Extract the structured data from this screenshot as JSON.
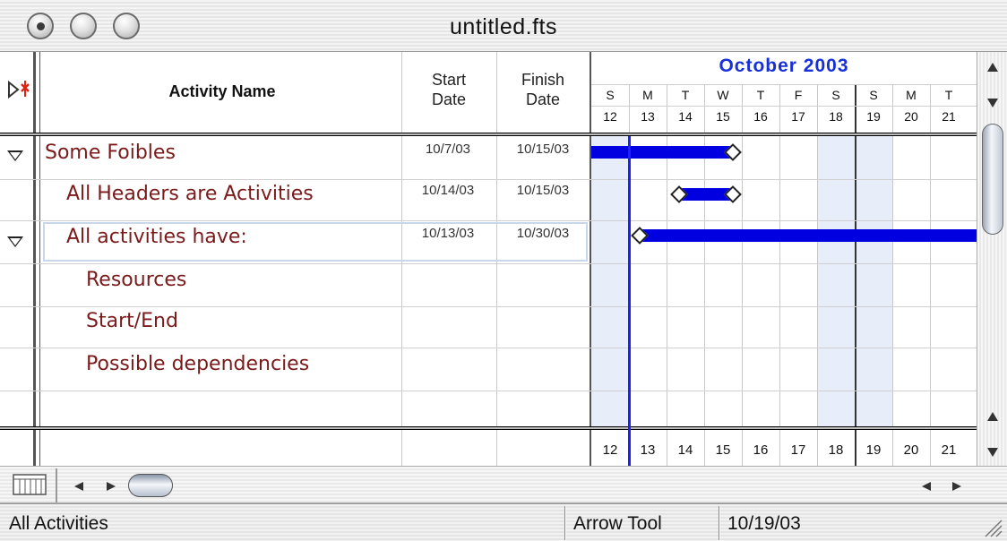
{
  "window": {
    "title": "untitled.fts"
  },
  "header": {
    "activity_name": "Activity Name",
    "start_line1": "Start",
    "start_line2": "Date",
    "finish_line1": "Finish",
    "finish_line2": "Date",
    "month": "October  2003",
    "day_letters": [
      "S",
      "M",
      "T",
      "W",
      "T",
      "F",
      "S",
      "S",
      "M",
      "T"
    ],
    "day_numbers": [
      "12",
      "13",
      "14",
      "15",
      "16",
      "17",
      "18",
      "19",
      "20",
      "21"
    ]
  },
  "rows": [
    {
      "name": "Some Foibles",
      "start": "10/7/03",
      "finish": "10/15/03",
      "expandable": true
    },
    {
      "name": "All Headers are Activities",
      "start": "10/14/03",
      "finish": "10/15/03",
      "expandable": false
    },
    {
      "name": "All activities have:",
      "start": "10/13/03",
      "finish": "10/30/03",
      "expandable": true
    },
    {
      "name": "Resources",
      "start": "",
      "finish": "",
      "expandable": false
    },
    {
      "name": "Start/End",
      "start": "",
      "finish": "",
      "expandable": false
    },
    {
      "name": "Possible dependencies",
      "start": "",
      "finish": "",
      "expandable": false
    }
  ],
  "footer_day_numbers": [
    "12",
    "13",
    "14",
    "15",
    "16",
    "17",
    "18",
    "19",
    "20",
    "21"
  ],
  "status": {
    "filter": "All Activities",
    "tool": "Arrow Tool",
    "date": "10/19/03"
  },
  "colors": {
    "activity_text": "#7a1a1a",
    "bar": "#0000e0",
    "month": "#1730d8",
    "today_line": "#2020ff"
  },
  "icons": [
    "close-light-icon",
    "minimize-light-icon",
    "zoom-light-icon",
    "collapse-outline-icon",
    "disclosure-triangle-icon",
    "calendar-grid-icon",
    "scroll-arrow-icon"
  ]
}
